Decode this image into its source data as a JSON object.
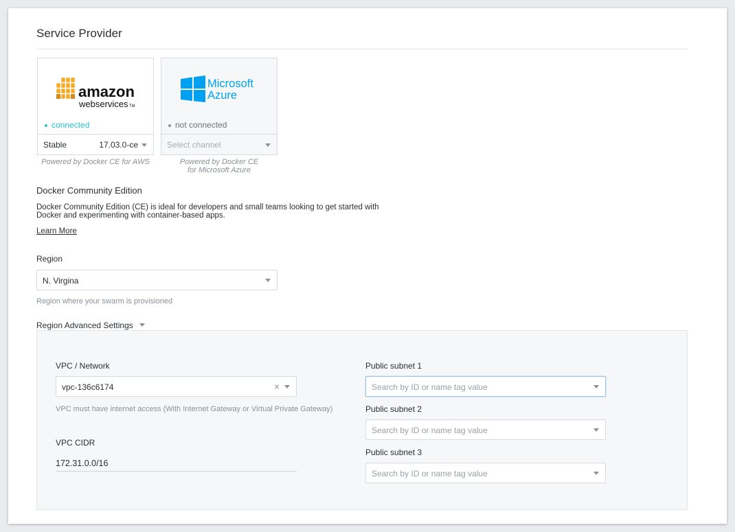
{
  "page": {
    "title": "Service Provider"
  },
  "providers": [
    {
      "status": "connected",
      "channel_label": "Stable",
      "channel_value": "17.03.0-ce",
      "powered_by": "Powered by Docker CE for AWS",
      "status_color": "#27c2d1"
    },
    {
      "logo_line1": "Microsoft",
      "logo_line2": "Azure",
      "status": "not connected",
      "channel_placeholder": "Select channel",
      "powered_by": "Powered by Docker CE for Microsoft Azure",
      "status_color": "#8a9097",
      "brand_color": "#00a1f1"
    }
  ],
  "edition": {
    "heading": "Docker Community Edition",
    "description": "Docker Community Edition (CE) is ideal for developers and small teams looking to get started with Docker and experimenting with container-based apps.",
    "learn_more": "Learn More"
  },
  "region": {
    "label": "Region",
    "value": "N. Virgina",
    "help": "Region where your swarm is provisioned"
  },
  "advanced": {
    "toggle_label": "Region Advanced Settings",
    "vpc": {
      "label": "VPC / Network",
      "value": "vpc-136c6174",
      "clear_glyph": "×",
      "help": "VPC must have internet access (With Internet Gateway or Virtual Private Gateway)"
    },
    "cidr": {
      "label": "VPC CIDR",
      "value": "172.31.0.0/16"
    },
    "subnets": [
      {
        "label": "Public subnet 1",
        "placeholder": "Search by ID or name tag value"
      },
      {
        "label": "Public subnet 2",
        "placeholder": "Search by ID or name tag value"
      },
      {
        "label": "Public subnet 3",
        "placeholder": "Search by ID or name tag value"
      }
    ]
  },
  "icons": {
    "aws": "amazon-web-services-logo-icon",
    "azure": "microsoft-azure-logo-icon",
    "dropdown": "chevron-down-icon",
    "clear": "close-icon"
  }
}
